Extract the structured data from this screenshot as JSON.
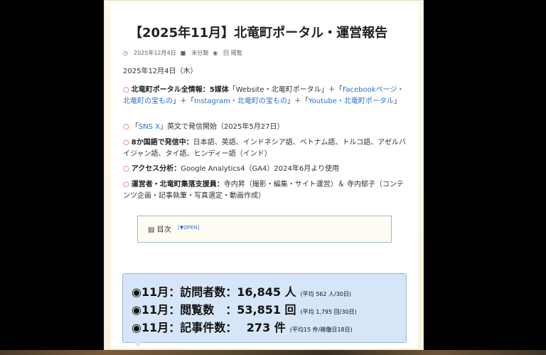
{
  "title": "【2025年11月】北竜町ポータル・運営報告",
  "meta": {
    "date": "2025年12月4日",
    "category": "未分類",
    "views": "回 閲覧"
  },
  "date_line": "2025年12月4日（木）",
  "bullets": [
    {
      "lead": "北竜町ポータル全情報：5媒体",
      "text": "「Website・北竜町ポータル」＋「",
      "link1": "Facebookページ・北竜町の宝もの",
      "text2": "」＋「",
      "link2": "Instagram・北竜町の宝もの",
      "text3": "」＋「",
      "link3": "Youtube・北竜町ポータル",
      "text4": "」"
    },
    {
      "lead": "",
      "text": "」英文で発信開始（2025年5月27日）",
      "link1": "SNS X",
      "prefix": "「"
    },
    {
      "lead": "8か国語で発信中：",
      "text": "日本語、英語、インドネシア語、ベトナム語、トルコ語、アゼルバイジャン語、タイ語、ヒンディー語（インド）"
    },
    {
      "lead": "アクセス分析：",
      "text": "Google Analytics4（GA4）2024年6月より使用"
    },
    {
      "lead": "運営者・北竜町集落支援員：",
      "text": "寺内昇（撮影・編集・サイト運営）＆ 寺内郁子（コンテンツ企画・記事執筆・写真選定・動画作成）"
    }
  ],
  "toc": {
    "label": "目次",
    "open": "[▼OPEN]"
  },
  "stats": [
    {
      "label": "◉11月：訪問者数：16,845 人",
      "note": "(平均 562 人/30日)"
    },
    {
      "label": "◉11月：閲覧数　：53,851 回",
      "note": "(平均 1,795 回/30日)"
    },
    {
      "label": "◉11月：記事件数：　 273 件",
      "note": "(平均15 件/稼働日18日)"
    }
  ],
  "colors": {
    "accent": "#2a6fd1",
    "bullet": "#e5483a",
    "stats_bg": "#d6e5f7"
  }
}
